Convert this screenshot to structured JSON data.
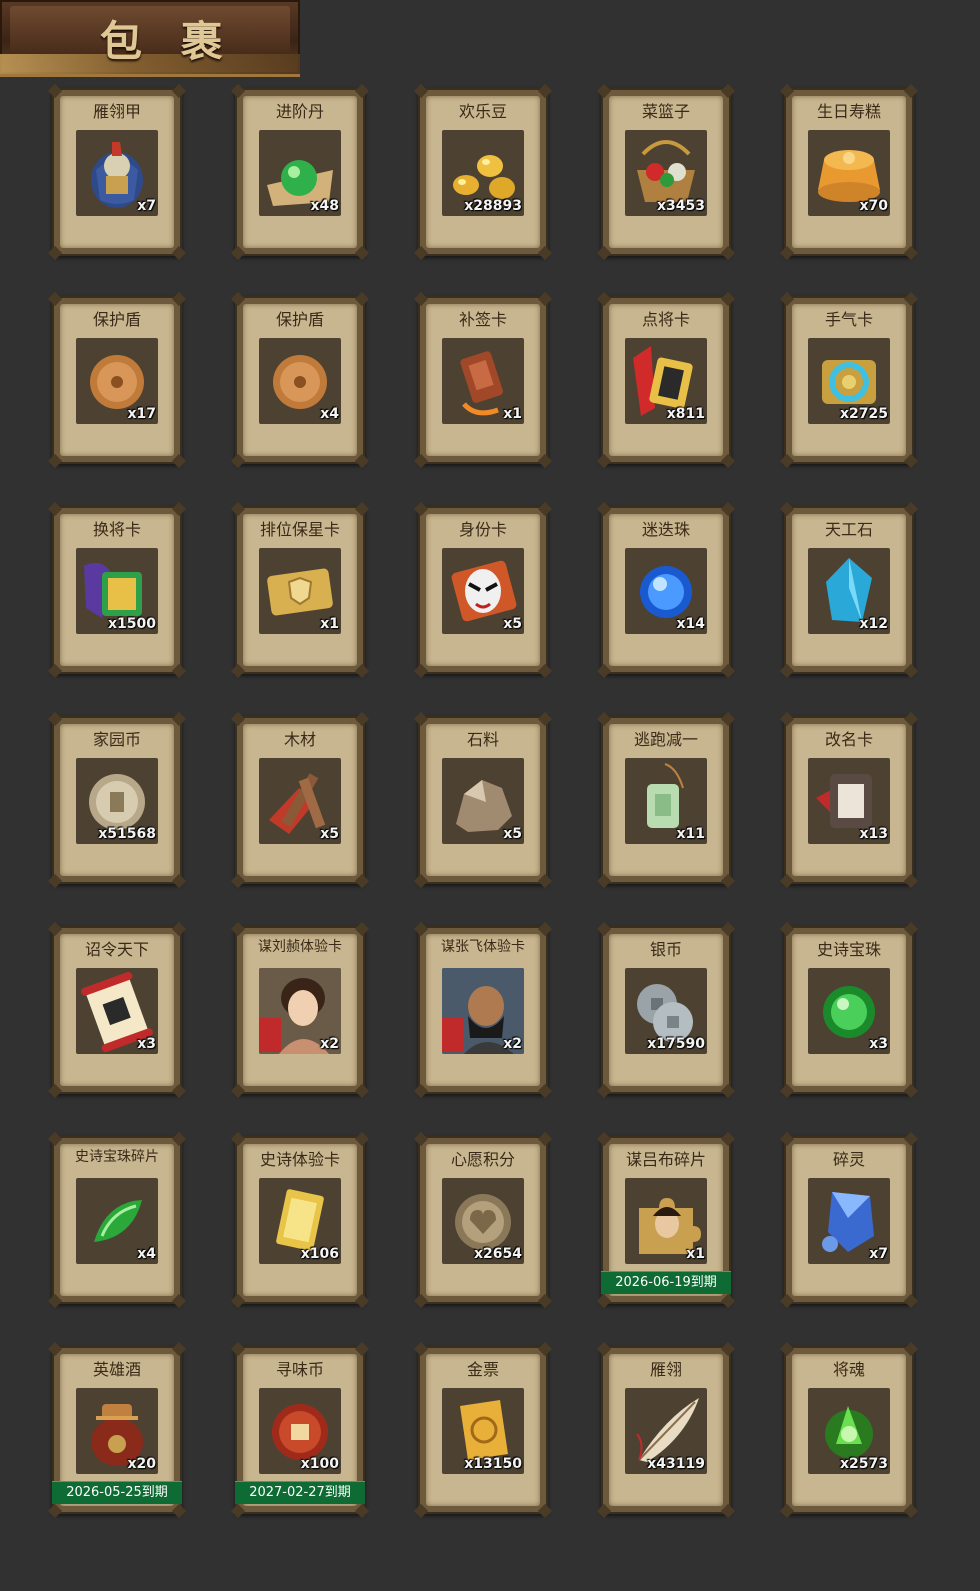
{
  "header": {
    "title": "包 裹"
  },
  "items": [
    {
      "name": "雁翎甲",
      "count": "x7",
      "icon": "armor-icon",
      "expiry": ""
    },
    {
      "name": "进阶丹",
      "count": "x48",
      "icon": "pill-icon",
      "expiry": ""
    },
    {
      "name": "欢乐豆",
      "count": "x28893",
      "icon": "beans-icon",
      "expiry": ""
    },
    {
      "name": "菜篮子",
      "count": "x3453",
      "icon": "basket-icon",
      "expiry": ""
    },
    {
      "name": "生日寿糕",
      "count": "x70",
      "icon": "cake-icon",
      "expiry": ""
    },
    {
      "name": "保护盾",
      "count": "x17",
      "icon": "shield-icon",
      "expiry": ""
    },
    {
      "name": "保护盾",
      "count": "x4",
      "icon": "shield-icon",
      "expiry": ""
    },
    {
      "name": "补签卡",
      "count": "x1",
      "icon": "tag-icon",
      "expiry": ""
    },
    {
      "name": "点将卡",
      "count": "x811",
      "icon": "general-card-icon",
      "expiry": ""
    },
    {
      "name": "手气卡",
      "count": "x2725",
      "icon": "luck-card-icon",
      "expiry": ""
    },
    {
      "name": "换将卡",
      "count": "x1500",
      "icon": "swap-card-icon",
      "expiry": ""
    },
    {
      "name": "排位保星卡",
      "count": "x1",
      "icon": "star-card-icon",
      "expiry": ""
    },
    {
      "name": "身份卡",
      "count": "x5",
      "icon": "mask-icon",
      "expiry": ""
    },
    {
      "name": "迷迭珠",
      "count": "x14",
      "icon": "blue-orb-icon",
      "expiry": ""
    },
    {
      "name": "天工石",
      "count": "x12",
      "icon": "crystal-icon",
      "expiry": ""
    },
    {
      "name": "家园币",
      "count": "x51568",
      "icon": "coin-icon",
      "expiry": ""
    },
    {
      "name": "木材",
      "count": "x5",
      "icon": "wood-icon",
      "expiry": ""
    },
    {
      "name": "石料",
      "count": "x5",
      "icon": "stone-icon",
      "expiry": ""
    },
    {
      "name": "逃跑减一",
      "count": "x11",
      "icon": "jade-tag-icon",
      "expiry": ""
    },
    {
      "name": "改名卡",
      "count": "x13",
      "icon": "rename-card-icon",
      "expiry": ""
    },
    {
      "name": "诏令天下",
      "count": "x3",
      "icon": "scroll-icon",
      "expiry": ""
    },
    {
      "name": "谋刘赪体验卡",
      "count": "x2",
      "icon": "female-portrait-icon",
      "expiry": ""
    },
    {
      "name": "谋张飞体验卡",
      "count": "x2",
      "icon": "male-portrait-icon",
      "expiry": ""
    },
    {
      "name": "银币",
      "count": "x17590",
      "icon": "silver-coin-icon",
      "expiry": ""
    },
    {
      "name": "史诗宝珠",
      "count": "x3",
      "icon": "green-orb-icon",
      "expiry": ""
    },
    {
      "name": "史诗宝珠碎片",
      "count": "x4",
      "icon": "green-shard-icon",
      "expiry": ""
    },
    {
      "name": "史诗体验卡",
      "count": "x106",
      "icon": "gold-card-icon",
      "expiry": ""
    },
    {
      "name": "心愿积分",
      "count": "x2654",
      "icon": "heart-coin-icon",
      "expiry": ""
    },
    {
      "name": "谋吕布碎片",
      "count": "x1",
      "icon": "puzzle-portrait-icon",
      "expiry": "2026-06-19到期"
    },
    {
      "name": "碎灵",
      "count": "x7",
      "icon": "spirit-shard-icon",
      "expiry": ""
    },
    {
      "name": "英雄酒",
      "count": "x20",
      "icon": "wine-jar-icon",
      "expiry": "2026-05-25到期"
    },
    {
      "name": "寻味币",
      "count": "x100",
      "icon": "taste-coin-icon",
      "expiry": "2027-02-27到期"
    },
    {
      "name": "金票",
      "count": "x13150",
      "icon": "gold-ticket-icon",
      "expiry": ""
    },
    {
      "name": "雁翎",
      "count": "x43119",
      "icon": "feather-icon",
      "expiry": ""
    },
    {
      "name": "将魂",
      "count": "x2573",
      "icon": "soul-icon",
      "expiry": ""
    }
  ]
}
